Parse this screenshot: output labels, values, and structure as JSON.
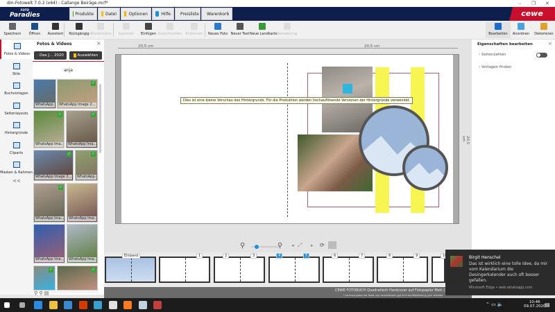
{
  "window": {
    "title": "dm-Fotowelt 7.0.2 (x64) - Callange Beiräge.mcf*",
    "minimize": "–",
    "restore": "❐",
    "close": "✕"
  },
  "header": {
    "logo_top": "FOTO",
    "logo": "Paradies",
    "brand": "cewe",
    "tabs": [
      {
        "label": "Produkte",
        "color": "#2e9e3a"
      },
      {
        "label": "Datei",
        "color": "#f5c000"
      },
      {
        "label": "Optionen",
        "color": "#f5b400"
      },
      {
        "label": "Hilfe",
        "color": "#1e90d8"
      },
      {
        "label": "Preisliste",
        "color": "#d02ea0"
      },
      {
        "label": "Warenkorb",
        "color": "#d0202a"
      }
    ]
  },
  "toolbar": {
    "items": [
      {
        "label": "Speichern",
        "enabled": true
      },
      {
        "label": "Öffnen",
        "enabled": true
      },
      {
        "label": "Assistent",
        "enabled": true
      },
      {
        "label": "Rückgängig",
        "enabled": true
      },
      {
        "label": "Wiederholen",
        "enabled": false
      },
      {
        "label": "Kopieren",
        "enabled": false
      },
      {
        "label": "Einfügen",
        "enabled": true
      },
      {
        "label": "Ausschneiden",
        "enabled": false
      },
      {
        "label": "Entfernen",
        "enabled": false
      },
      {
        "label": "Neues Foto",
        "enabled": true
      },
      {
        "label": "Neuer Text",
        "enabled": true
      },
      {
        "label": "Neue Landkarte",
        "enabled": true
      },
      {
        "label": "Veredelung",
        "enabled": false
      }
    ],
    "modes": [
      {
        "label": "Bearbeiten",
        "active": true
      },
      {
        "label": "Anordnen",
        "active": false
      },
      {
        "label": "Dekorieren",
        "active": false
      }
    ]
  },
  "leftnav": {
    "items": [
      "Fotos & Videos",
      "Stile",
      "Buchvorlagen",
      "Seitenlayouts",
      "Hintergründe",
      "Cliparts",
      "Masken & Rahmen"
    ],
    "collapse": "<<"
  },
  "photos_panel": {
    "title": "Fotos & Videos",
    "close": "×",
    "back_label": "Das J... 2020",
    "select_label": "Auswählen",
    "folder": "anja",
    "photos": [
      {
        "caption": "WhatsApp ...",
        "checked": false
      },
      {
        "caption": "WhatsApp Image 2...",
        "checked": true
      },
      {
        "caption": "WhatsApp Ima...",
        "checked": true
      },
      {
        "caption": "WhatsApp Ima...",
        "checked": true
      },
      {
        "caption": "WhatsApp Image 2...",
        "checked": true
      },
      {
        "caption": "WhatsApp...",
        "checked": true
      },
      {
        "caption": "WhatsApp Ima...",
        "checked": true
      },
      {
        "caption": "WhatsApp Ima...",
        "checked": false
      },
      {
        "caption": "WhatsApp Ima...",
        "checked": false
      },
      {
        "caption": "WhatsApp Ima...",
        "checked": false
      },
      {
        "caption": "",
        "checked": true
      },
      {
        "caption": "",
        "checked": true
      }
    ]
  },
  "canvas": {
    "ruler_left": "20,5 cm",
    "ruler_right": "20,5 cm",
    "ruler_vertical": "20,5 cm",
    "tooltip": "Dies ist eine kleine Vorschau des Hintergrunds. Für die Produktion werden hochauflösende Versionen der Hintergründe verwendet.",
    "zoom_level": 0.2
  },
  "properties": {
    "title": "Eigenschaften bearbeiten",
    "close": "×",
    "items": [
      {
        "label": "Seitenzahlen",
        "toggle": false
      },
      {
        "label": "Vorlagen finden"
      }
    ]
  },
  "pages": {
    "cover_label": "Einband",
    "numbers": [
      "1",
      "2",
      "3",
      "4",
      "5",
      "6",
      "7",
      "8",
      "9",
      "10"
    ],
    "selected": [
      "4",
      "5"
    ]
  },
  "status": {
    "product": "CEWE FOTOBUCH Quadratisch Hardcover auf Fotopapier Matt (26 S.) 31,5...",
    "note": "* Die Preise gelten inkl. MwSt. zzgl. Versandkosten (ggf. auch bei Filialabholung) gem. Preisliste"
  },
  "notification": {
    "sender": "Birgit Henschel",
    "message": "Das ist wirklich eine tolle Idee, da mir vom Kalendarium die Desingerkalender auch oft besser gefallen.",
    "source": "Microsoft Edge • web.whatsapp.com"
  },
  "taskbar": {
    "time": "10:46",
    "date": "09.07.2020",
    "apps": [
      "windows-start",
      "task-view",
      "edge",
      "file-explorer",
      "store",
      "office",
      "media-player",
      "brave",
      "firefox",
      "snipping",
      "fotowelt"
    ]
  }
}
